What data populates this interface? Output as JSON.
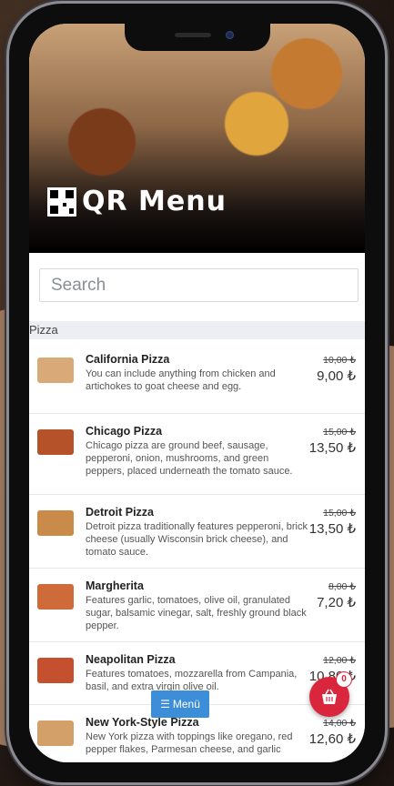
{
  "app": {
    "brand": "QR Menu",
    "search_placeholder": "Search"
  },
  "category": {
    "name": "Pizza"
  },
  "items": [
    {
      "name": "California Pizza",
      "description": "You can include anything from chicken and artichokes to goat cheese and egg.",
      "old_price": "10,00 ₺",
      "price": "9,00 ₺",
      "thumb_color": "#d9a978"
    },
    {
      "name": "Chicago Pizza",
      "description": "Chicago pizza are ground beef, sausage, pepperoni, onion, mushrooms, and green peppers, placed underneath the tomato sauce.",
      "old_price": "15,00 ₺",
      "price": "13,50 ₺",
      "thumb_color": "#b5522a"
    },
    {
      "name": "Detroit Pizza",
      "description": "Detroit pizza traditionally features pepperoni, brick cheese (usually Wisconsin brick cheese), and tomato sauce.",
      "old_price": "15,00 ₺",
      "price": "13,50 ₺",
      "thumb_color": "#c98a4a"
    },
    {
      "name": "Margherita",
      "description": "Features garlic, tomatoes, olive oil, granulated sugar, balsamic vinegar, salt, freshly ground black pepper.",
      "old_price": "8,00 ₺",
      "price": "7,20 ₺",
      "thumb_color": "#cf6a3a"
    },
    {
      "name": "Neapolitan Pizza",
      "description": "Features tomatoes, mozzarella from Campania, basil, and extra virgin olive oil.",
      "old_price": "12,00 ₺",
      "price": "10,80 ₺",
      "thumb_color": "#c4502e"
    },
    {
      "name": "New York-Style Pizza",
      "description": "New York pizza with toppings like oregano, red pepper flakes, Parmesan cheese, and garlic",
      "old_price": "14,00 ₺",
      "price": "12,60 ₺",
      "thumb_color": "#d4a06a"
    }
  ],
  "footer": {
    "menu_label": "Menü",
    "cart_count": "0"
  },
  "colors": {
    "menu_button": "#3d8ed8",
    "cart_button": "#d9263d"
  }
}
